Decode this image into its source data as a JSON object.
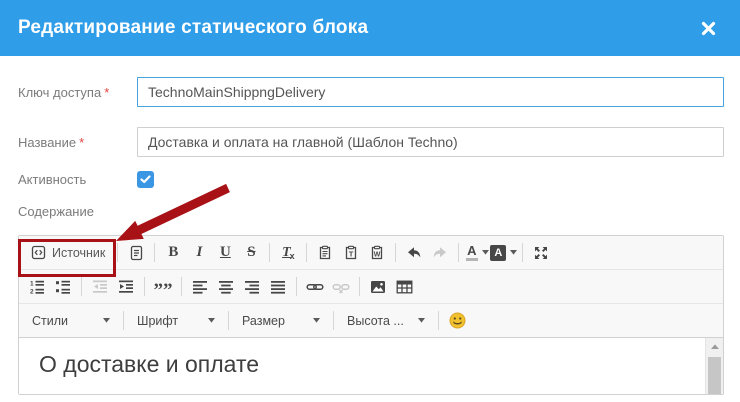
{
  "modal": {
    "title": "Редактирование статического блока"
  },
  "form": {
    "access_key": {
      "label": "Ключ доступа",
      "required": "*",
      "value": "TechnoMainShippngDelivery"
    },
    "name": {
      "label": "Название",
      "required": "*",
      "value": "Доставка и оплата на главной (Шаблон Techno)"
    },
    "activity": {
      "label": "Активность",
      "checked": true
    },
    "content": {
      "label": "Содержание"
    }
  },
  "editor": {
    "source_label": "Источник",
    "glyphs": {
      "bold": "B",
      "italic": "I",
      "underline": "U",
      "strike": "S",
      "remove_t": "T",
      "remove_x": "x",
      "paste_t": "T",
      "paste_w": "W",
      "color_a": "A",
      "bgcolor_a": "A",
      "ol_1": "1",
      "ol_2": "2",
      "quote": "””"
    },
    "dropdowns": {
      "styles": "Стили",
      "font": "Шрифт",
      "size": "Размер",
      "height": "Высота ..."
    },
    "content_heading": "О доставке и оплате"
  },
  "colors": {
    "header_blue": "#2f9de8",
    "annotation_red": "#a81216",
    "checkbox_blue": "#3b97e3",
    "focused_input_border": "#4aa3df",
    "required_red": "#e0433e"
  }
}
